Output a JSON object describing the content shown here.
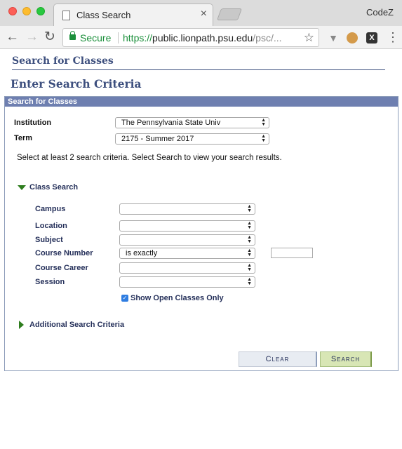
{
  "browser": {
    "tab_title": "Class Search",
    "tab_close": "×",
    "profile_name": "CodeZ",
    "secure_label": "Secure",
    "url_scheme": "https://",
    "url_host": "public.lionpath.psu.edu",
    "url_path": "/psc/...",
    "back": "←",
    "forward": "→",
    "reload": "↻",
    "star": "☆",
    "menu": "⋮",
    "ext_v": "▼",
    "ext_x": "X",
    "icons": [
      "document-icon",
      "lock-icon",
      "star-icon",
      "cookie-extension-icon",
      "x-extension-icon",
      "menu-icon"
    ]
  },
  "page": {
    "header": "Search for Classes",
    "title": "Enter Search Criteria",
    "panel_title": "Search for Classes",
    "institution_label": "Institution",
    "institution_value": "The Pennsylvania State Univ",
    "term_label": "Term",
    "term_value": "2175 - Summer 2017",
    "instruction": "Select at least 2 search criteria. Select Search to view your search results.",
    "class_search_title": "Class Search",
    "fields": {
      "campus_label": "Campus",
      "campus_value": "",
      "location_label": "Location",
      "location_value": "",
      "subject_label": "Subject",
      "subject_value": "",
      "course_number_label": "Course Number",
      "course_number_operator": "is exactly",
      "course_number_value": "",
      "course_career_label": "Course Career",
      "course_career_value": "",
      "session_label": "Session",
      "session_value": ""
    },
    "show_open_label": "Show Open Classes Only",
    "show_open_checked": true,
    "additional_title": "Additional Search Criteria",
    "clear_button": "Clear",
    "search_button": "Search"
  },
  "colors": {
    "brand_navy": "#3d4f7e",
    "panel_header": "#6e7fb0",
    "toggle_green": "#2e7d1e",
    "secure_green": "#1a8f3a",
    "search_button_bg": "#d8e6b5"
  }
}
